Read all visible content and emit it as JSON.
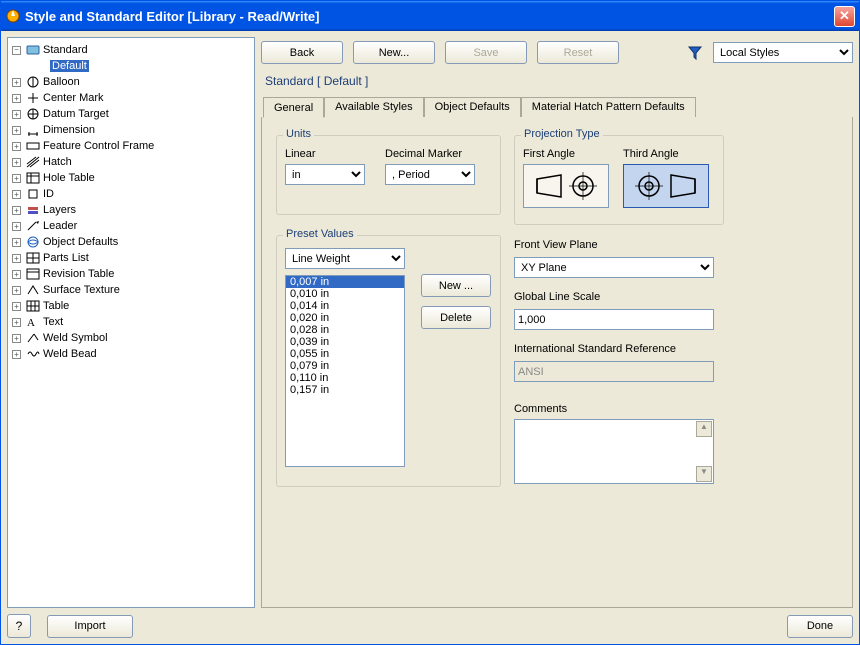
{
  "window": {
    "title": "Style and Standard Editor [Library - Read/Write]"
  },
  "tree": {
    "root": "Standard",
    "items": [
      {
        "label": "Default",
        "selected": true,
        "child": true
      },
      {
        "label": "Balloon"
      },
      {
        "label": "Center Mark"
      },
      {
        "label": "Datum Target"
      },
      {
        "label": "Dimension"
      },
      {
        "label": "Feature Control Frame"
      },
      {
        "label": "Hatch"
      },
      {
        "label": "Hole Table"
      },
      {
        "label": "ID"
      },
      {
        "label": "Layers"
      },
      {
        "label": "Leader"
      },
      {
        "label": "Object Defaults"
      },
      {
        "label": "Parts List"
      },
      {
        "label": "Revision Table"
      },
      {
        "label": "Surface Texture"
      },
      {
        "label": "Table"
      },
      {
        "label": "Text"
      },
      {
        "label": "Weld Symbol"
      },
      {
        "label": "Weld Bead"
      }
    ]
  },
  "toolbar": {
    "back": "Back",
    "new": "New...",
    "save": "Save",
    "reset": "Reset",
    "styles_combo": "Local Styles"
  },
  "breadcrumb": "Standard [ Default ]",
  "tabs": {
    "t0": "General",
    "t1": "Available Styles",
    "t2": "Object Defaults",
    "t3": "Material Hatch Pattern Defaults"
  },
  "units": {
    "title": "Units",
    "linear_label": "Linear",
    "linear_value": "in",
    "decimal_label": "Decimal Marker",
    "decimal_value": ", Period"
  },
  "projection": {
    "title": "Projection Type",
    "first_label": "First Angle",
    "third_label": "Third Angle"
  },
  "presets": {
    "title": "Preset Values",
    "category": "Line Weight",
    "new_btn": "New ...",
    "delete_btn": "Delete",
    "values": [
      "0,007 in",
      "0,010 in",
      "0,014 in",
      "0,020 in",
      "0,028 in",
      "0,039 in",
      "0,055 in",
      "0,079 in",
      "0,110 in",
      "0,157 in"
    ]
  },
  "right_fields": {
    "front_view_label": "Front View Plane",
    "front_view_value": "XY Plane",
    "line_scale_label": "Global Line Scale",
    "line_scale_value": "1,000",
    "intl_ref_label": "International Standard Reference",
    "intl_ref_value": "ANSI",
    "comments_label": "Comments"
  },
  "footer": {
    "import": "Import",
    "done": "Done"
  }
}
